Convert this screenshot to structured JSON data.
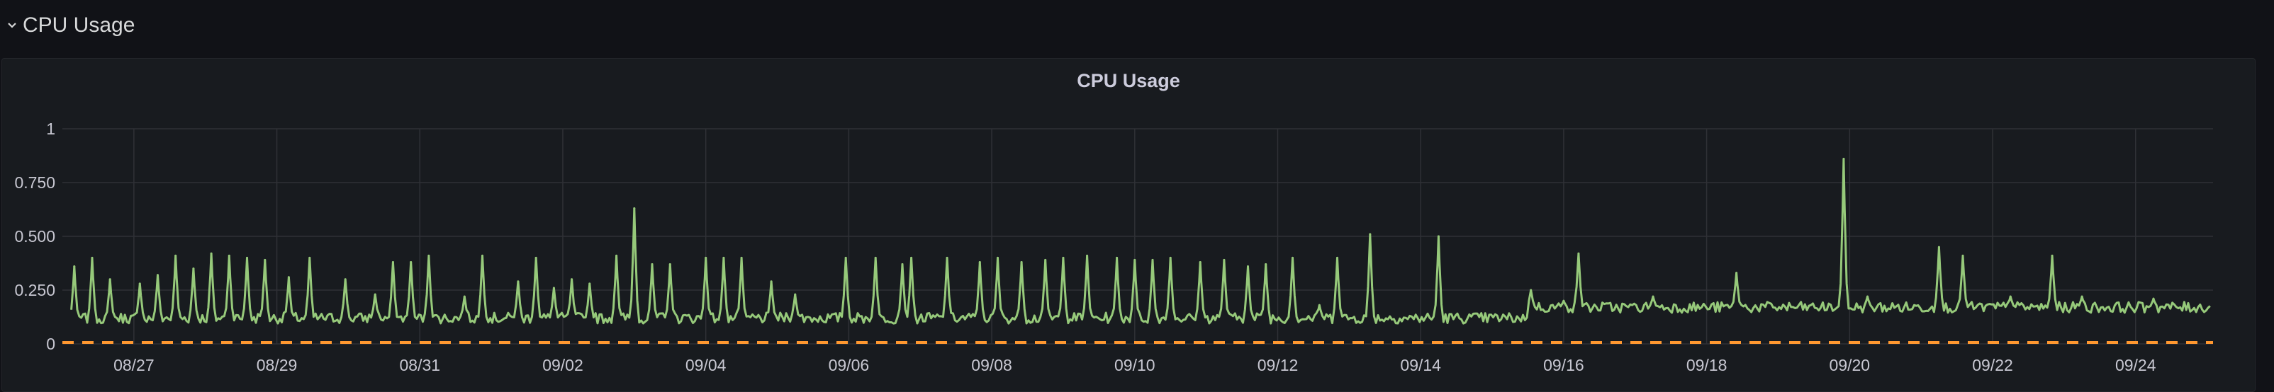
{
  "row": {
    "title": "CPU Usage",
    "chevron": "chevron-down-icon"
  },
  "panel": {
    "title": "CPU Usage"
  },
  "colors": {
    "series": "#96c97a",
    "threshold": "#ff9830",
    "grid": "#2f3136",
    "background": "#181b1f"
  },
  "chart_data": {
    "type": "line",
    "title": "CPU Usage",
    "xlabel": "",
    "ylabel": "",
    "ylim": [
      0,
      1
    ],
    "y_ticks": [
      "0",
      "0.250",
      "0.500",
      "0.750",
      "1"
    ],
    "x_ticks": [
      "08/27",
      "08/29",
      "08/31",
      "09/02",
      "09/04",
      "09/06",
      "09/08",
      "09/10",
      "09/12",
      "09/14",
      "09/16",
      "09/18",
      "09/20",
      "09/22",
      "09/24"
    ],
    "grid": true,
    "legend": "none",
    "x_range_days": [
      "08/26",
      "09/25"
    ],
    "series": [
      {
        "baseline_before_0915": 0.12,
        "baseline_after_0915": 0.17,
        "peaks": [
          {
            "x": "08/26 04:00",
            "y": 0.36
          },
          {
            "x": "08/26 10:00",
            "y": 0.4
          },
          {
            "x": "08/26 16:00",
            "y": 0.3
          },
          {
            "x": "08/27 02:00",
            "y": 0.28
          },
          {
            "x": "08/27 08:00",
            "y": 0.32
          },
          {
            "x": "08/27 14:00",
            "y": 0.41
          },
          {
            "x": "08/27 20:00",
            "y": 0.35
          },
          {
            "x": "08/28 02:00",
            "y": 0.42
          },
          {
            "x": "08/28 08:00",
            "y": 0.41
          },
          {
            "x": "08/28 14:00",
            "y": 0.4
          },
          {
            "x": "08/28 20:00",
            "y": 0.39
          },
          {
            "x": "08/29 04:00",
            "y": 0.31
          },
          {
            "x": "08/29 11:00",
            "y": 0.4
          },
          {
            "x": "08/29 23:00",
            "y": 0.3
          },
          {
            "x": "08/30 09:00",
            "y": 0.23
          },
          {
            "x": "08/30 15:00",
            "y": 0.38
          },
          {
            "x": "08/30 21:00",
            "y": 0.38
          },
          {
            "x": "08/31 03:00",
            "y": 0.41
          },
          {
            "x": "08/31 15:00",
            "y": 0.22
          },
          {
            "x": "08/31 21:00",
            "y": 0.41
          },
          {
            "x": "09/01 09:00",
            "y": 0.29
          },
          {
            "x": "09/01 15:00",
            "y": 0.4
          },
          {
            "x": "09/01 21:00",
            "y": 0.26
          },
          {
            "x": "09/02 03:00",
            "y": 0.3
          },
          {
            "x": "09/02 09:00",
            "y": 0.28
          },
          {
            "x": "09/02 18:00",
            "y": 0.41
          },
          {
            "x": "09/03 00:00",
            "y": 0.63
          },
          {
            "x": "09/03 06:00",
            "y": 0.37
          },
          {
            "x": "09/03 12:00",
            "y": 0.37
          },
          {
            "x": "09/04 00:00",
            "y": 0.4
          },
          {
            "x": "09/04 06:00",
            "y": 0.4
          },
          {
            "x": "09/04 12:00",
            "y": 0.4
          },
          {
            "x": "09/04 22:00",
            "y": 0.29
          },
          {
            "x": "09/05 06:00",
            "y": 0.23
          },
          {
            "x": "09/05 23:00",
            "y": 0.4
          },
          {
            "x": "09/06 09:00",
            "y": 0.4
          },
          {
            "x": "09/06 18:00",
            "y": 0.37
          },
          {
            "x": "09/06 21:00",
            "y": 0.4
          },
          {
            "x": "09/07 09:00",
            "y": 0.4
          },
          {
            "x": "09/07 20:00",
            "y": 0.38
          },
          {
            "x": "09/08 02:00",
            "y": 0.4
          },
          {
            "x": "09/08 10:00",
            "y": 0.38
          },
          {
            "x": "09/08 18:00",
            "y": 0.39
          },
          {
            "x": "09/09 00:00",
            "y": 0.4
          },
          {
            "x": "09/09 08:00",
            "y": 0.41
          },
          {
            "x": "09/09 18:00",
            "y": 0.4
          },
          {
            "x": "09/10 00:00",
            "y": 0.39
          },
          {
            "x": "09/10 06:00",
            "y": 0.39
          },
          {
            "x": "09/10 12:00",
            "y": 0.4
          },
          {
            "x": "09/10 22:00",
            "y": 0.38
          },
          {
            "x": "09/11 06:00",
            "y": 0.39
          },
          {
            "x": "09/11 14:00",
            "y": 0.36
          },
          {
            "x": "09/11 20:00",
            "y": 0.37
          },
          {
            "x": "09/12 05:00",
            "y": 0.4
          },
          {
            "x": "09/12 14:00",
            "y": 0.18
          },
          {
            "x": "09/12 20:00",
            "y": 0.4
          },
          {
            "x": "09/13 07:00",
            "y": 0.51
          },
          {
            "x": "09/14 06:00",
            "y": 0.5
          },
          {
            "x": "09/15 13:00",
            "y": 0.25
          },
          {
            "x": "09/16 00:00",
            "y": 0.2
          },
          {
            "x": "09/16 05:00",
            "y": 0.42
          },
          {
            "x": "09/17 06:00",
            "y": 0.22
          },
          {
            "x": "09/18 10:00",
            "y": 0.33
          },
          {
            "x": "09/19 22:00",
            "y": 0.86
          },
          {
            "x": "09/20 06:00",
            "y": 0.22
          },
          {
            "x": "09/21 06:00",
            "y": 0.45
          },
          {
            "x": "09/21 14:00",
            "y": 0.41
          },
          {
            "x": "09/22 06:00",
            "y": 0.22
          },
          {
            "x": "09/22 20:00",
            "y": 0.41
          },
          {
            "x": "09/23 06:00",
            "y": 0.22
          },
          {
            "x": "09/24 06:00",
            "y": 0.21
          }
        ]
      }
    ],
    "threshold": 0
  }
}
